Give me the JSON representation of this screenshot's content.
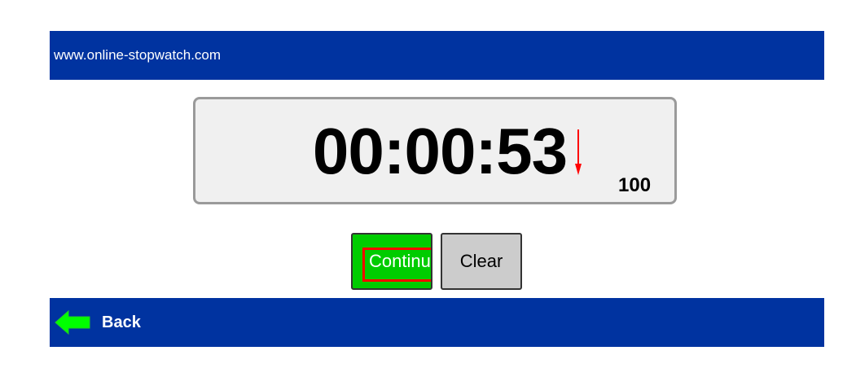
{
  "header": {
    "site_url": "www.online-stopwatch.com"
  },
  "stopwatch": {
    "time": "00:00:53",
    "hundredths": "100",
    "direction_icon": "down-arrow-icon",
    "direction_color": "#ff0000"
  },
  "controls": {
    "continue_label": "Continu",
    "clear_label": "Clear",
    "continue_color": "#00cc00",
    "clear_color": "#cccccc"
  },
  "footer": {
    "back_label": "Back",
    "back_icon": "back-arrow-icon",
    "back_icon_color": "#00ff00"
  },
  "theme": {
    "bar_color": "#0033a0"
  }
}
